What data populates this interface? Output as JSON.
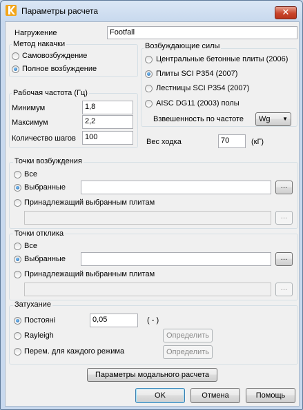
{
  "window": {
    "title": "Параметры расчета",
    "close_glyph": "✕"
  },
  "loading": {
    "label": "Нагружение",
    "value": "Footfall"
  },
  "method": {
    "title": "Метод накачки",
    "options": [
      {
        "label": "Самовозбуждение",
        "selected": false
      },
      {
        "label": "Полное возбуждение",
        "selected": true
      }
    ]
  },
  "frequency": {
    "title": "Рабочая частота (Гц)",
    "min_label": "Минимум",
    "min_value": "1,8",
    "max_label": "Максимум",
    "max_value": "2,2",
    "steps_label": "Количество шагов",
    "steps_value": "100"
  },
  "forces": {
    "title": "Возбуждающие силы",
    "options": [
      {
        "label": "Центральные бетонные плиты (2006)",
        "selected": false
      },
      {
        "label": "Плиты SCI P354 (2007)",
        "selected": true
      },
      {
        "label": "Лестницы SCI P354 (2007)",
        "selected": false
      },
      {
        "label": "AISC DG11 (2003) полы",
        "selected": false
      }
    ],
    "weighting_label": "Взвешенность по частоте",
    "weighting_value": "Wg"
  },
  "walk_weight": {
    "label": "Вес ходка",
    "value": "70",
    "unit": "(кГ)"
  },
  "excitation_points": {
    "title": "Точки возбуждения",
    "all_label": "Все",
    "selected_label": "Выбранные",
    "selected_value": "",
    "plates_label": "Принадлежащий выбранным плитам",
    "plates_value": "",
    "browse_label": "...",
    "option_selected": "selected"
  },
  "response_points": {
    "title": "Точки отклика",
    "all_label": "Все",
    "selected_label": "Выбранные",
    "selected_value": "",
    "plates_label": "Принадлежащий выбранным плитам",
    "plates_value": "",
    "browse_label": "...",
    "option_selected": "selected"
  },
  "damping": {
    "title": "Затухание",
    "constant_label": "Постоянi",
    "constant_value": "0,05",
    "constant_unit": "( - )",
    "rayleigh_label": "Rayleigh",
    "per_mode_label": "Перем. для каждого режима",
    "define_label": "Определить",
    "option_selected": "constant"
  },
  "modal_button": "Параметры модального расчета",
  "buttons": {
    "ok": "OK",
    "cancel": "Отмена",
    "help": "Помощь"
  }
}
